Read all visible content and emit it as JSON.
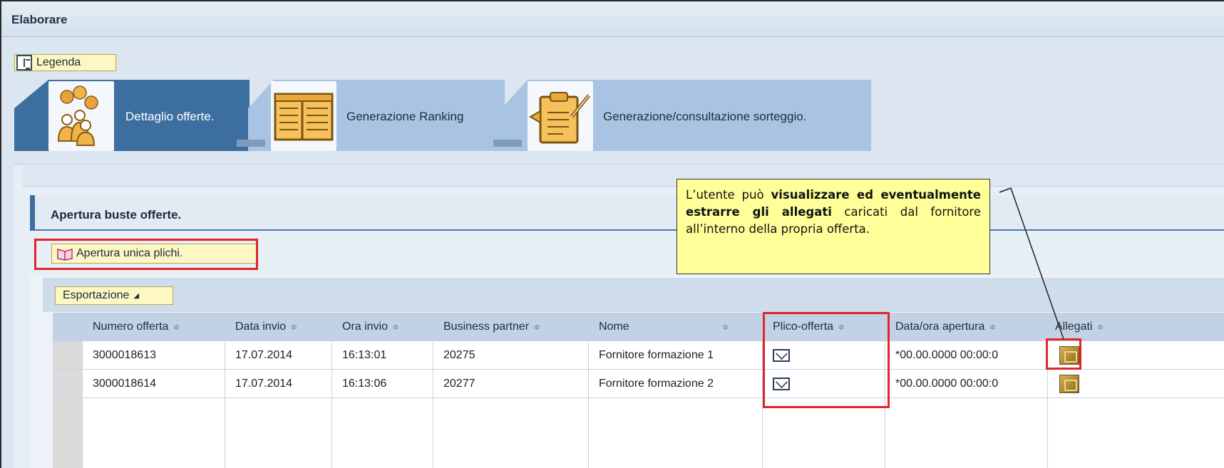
{
  "window": {
    "title": "Elaborare"
  },
  "legend_button": {
    "label": "Legenda"
  },
  "tabs": [
    {
      "label": "Dettaglio offerte.",
      "icon": "coins-people-icon",
      "active": true
    },
    {
      "label": "Generazione Ranking",
      "icon": "ranking-table-icon",
      "active": false
    },
    {
      "label": "Generazione/consultazione sorteggio.",
      "icon": "clipboard-pen-icon",
      "active": false
    }
  ],
  "section": {
    "title": "Apertura buste offerte."
  },
  "toolbar": {
    "open_label": "Apertura unica plichi.",
    "export_label": "Esportazione"
  },
  "table": {
    "columns": [
      "Numero offerta",
      "Data invio",
      "Ora invio",
      "Business partner",
      "Nome",
      "Plico-offerta",
      "Data/ora apertura",
      "Allegati"
    ],
    "rows": [
      {
        "numero": "3000018613",
        "data": "17.07.2014",
        "ora": "16:13:01",
        "bp": "20275",
        "nome": "Fornitore formazione 1",
        "apertura": "*00.00.0000 00:00:0"
      },
      {
        "numero": "3000018614",
        "data": "17.07.2014",
        "ora": "16:13:06",
        "bp": "20277",
        "nome": "Fornitore formazione 2",
        "apertura": "*00.00.0000 00:00:0"
      }
    ]
  },
  "callout": {
    "text_1": "L’utente può ",
    "bold": "visualizzare ed eventualmente estrarre gli allegati",
    "text_2": " caricati dal fornitore all’interno della propria offerta."
  },
  "colors": {
    "highlight": "#e0262b",
    "callout_bg": "#ffff99",
    "tab_active": "#3c6e9f",
    "button_bg": "#fdf7c4"
  }
}
